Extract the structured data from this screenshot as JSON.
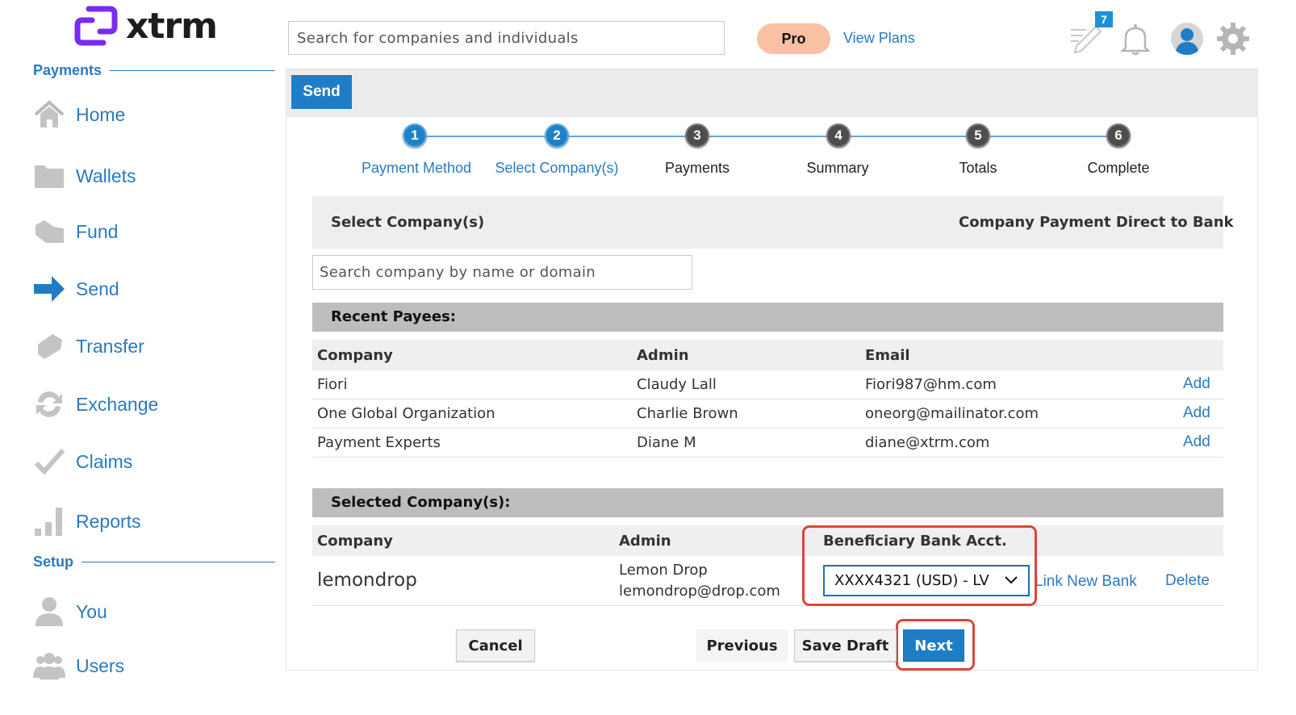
{
  "app": {
    "name": "xtrm",
    "brand_color": "#7a2bf0",
    "accent_color": "#2a7ac0"
  },
  "sidebar": {
    "payments_heading": "Payments",
    "setup_heading": "Setup",
    "payments_items": [
      {
        "label": "Home",
        "icon": "home-icon"
      },
      {
        "label": "Wallets",
        "icon": "folder-icon"
      },
      {
        "label": "Fund",
        "icon": "fund-icon"
      },
      {
        "label": "Send",
        "icon": "send-arrow-icon"
      },
      {
        "label": "Transfer",
        "icon": "transfer-icon"
      },
      {
        "label": "Exchange",
        "icon": "exchange-icon"
      },
      {
        "label": "Claims",
        "icon": "checkmark-icon"
      },
      {
        "label": "Reports",
        "icon": "bar-chart-icon"
      }
    ],
    "setup_items": [
      {
        "label": "You",
        "icon": "person-icon"
      },
      {
        "label": "Users",
        "icon": "users-icon"
      }
    ]
  },
  "topbar": {
    "search_placeholder": "Search for companies and individuals",
    "pro_label": "Pro",
    "view_plans": "View Plans",
    "notes_badge": "7"
  },
  "send": {
    "tab_label": "Send",
    "steps": [
      {
        "num": "1",
        "label": "Payment Method",
        "state": "active"
      },
      {
        "num": "2",
        "label": "Select Company(s)",
        "state": "active"
      },
      {
        "num": "3",
        "label": "Payments",
        "state": "inactive"
      },
      {
        "num": "4",
        "label": "Summary",
        "state": "inactive"
      },
      {
        "num": "5",
        "label": "Totals",
        "state": "inactive"
      },
      {
        "num": "6",
        "label": "Complete",
        "state": "inactive"
      }
    ],
    "select_title": "Select Company(s)",
    "select_right": "Company Payment Direct to Bank",
    "company_search_placeholder": "Search company by name or domain",
    "recent": {
      "title": "Recent Payees:",
      "headers": [
        "Company",
        "Admin",
        "Email"
      ],
      "rows": [
        {
          "company": "Fiori",
          "admin": "Claudy Lall",
          "email": "Fiori987@hm.com",
          "action": "Add"
        },
        {
          "company": "One Global Organization",
          "admin": "Charlie Brown",
          "email": "oneorg@mailinator.com",
          "action": "Add"
        },
        {
          "company": "Payment Experts",
          "admin": "Diane M",
          "email": "diane@xtrm.com",
          "action": "Add"
        }
      ]
    },
    "selected": {
      "title": "Selected Company(s):",
      "headers": [
        "Company",
        "Admin",
        "Beneficiary Bank Acct."
      ],
      "row": {
        "company": "lemondrop",
        "admin_name": "Lemon Drop",
        "admin_email": "lemondrop@drop.com",
        "bank_account": "XXXX4321 (USD) - LV",
        "link_bank": "Link New Bank",
        "delete": "Delete"
      }
    },
    "buttons": {
      "cancel": "Cancel",
      "previous": "Previous",
      "save_draft": "Save Draft",
      "next": "Next"
    }
  }
}
